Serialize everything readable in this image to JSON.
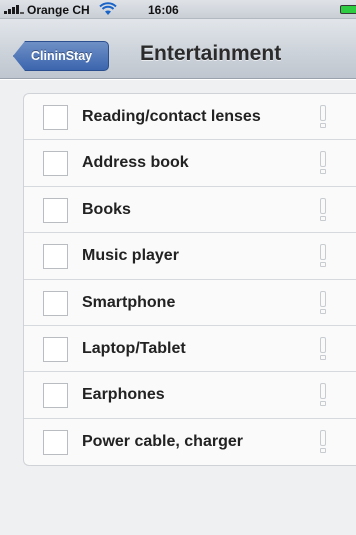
{
  "status_bar": {
    "carrier": "Orange CH",
    "time": "16:06",
    "wifi_icon": "wifi-icon",
    "battery_color": "#2ecc40"
  },
  "navbar": {
    "back_label": "ClininStay",
    "title": "Entertainment"
  },
  "checklist": {
    "items": [
      {
        "label": "Reading/contact lenses",
        "checked": false,
        "icon": "info-icon"
      },
      {
        "label": "Address book",
        "checked": false,
        "icon": "info-icon"
      },
      {
        "label": "Books",
        "checked": false,
        "icon": "info-icon"
      },
      {
        "label": "Music player",
        "checked": false,
        "icon": "info-icon"
      },
      {
        "label": "Smartphone",
        "checked": false,
        "icon": "info-icon"
      },
      {
        "label": "Laptop/Tablet",
        "checked": false,
        "icon": "info-icon"
      },
      {
        "label": "Earphones",
        "checked": false,
        "icon": "info-icon"
      },
      {
        "label": "Power cable, charger",
        "checked": false,
        "icon": "info-icon"
      }
    ]
  },
  "colors": {
    "back_button": "#3b65ae",
    "background": "#eef0f2"
  }
}
